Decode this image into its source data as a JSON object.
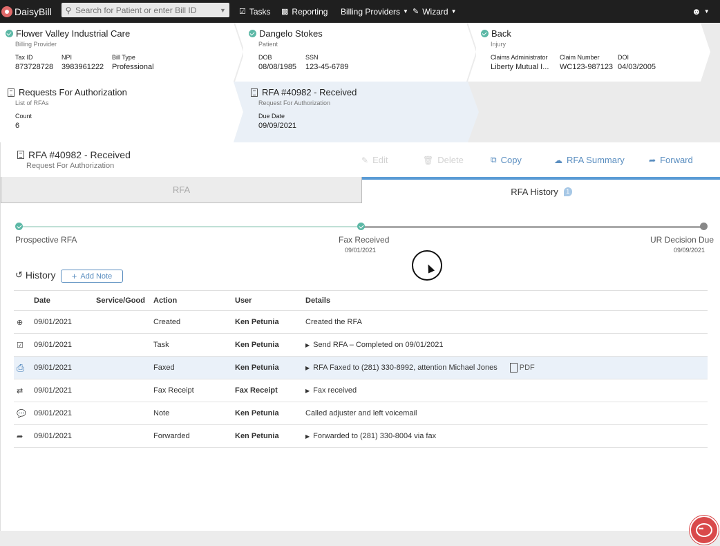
{
  "nav": {
    "logo_text": "DaisyBill",
    "search_placeholder": "Search for Patient or enter Bill ID",
    "tasks": "Tasks",
    "reporting": "Reporting",
    "billing_providers": "Billing Providers",
    "wizard": "Wizard"
  },
  "provider_card": {
    "title": "Flower Valley Industrial Care",
    "subtitle": "Billing Provider",
    "fields": [
      {
        "label": "Tax ID",
        "value": "873728728"
      },
      {
        "label": "NPI",
        "value": "3983961222"
      },
      {
        "label": "Bill Type",
        "value": "Professional"
      }
    ]
  },
  "patient_card": {
    "title": "Dangelo Stokes",
    "subtitle": "Patient",
    "fields": [
      {
        "label": "DOB",
        "value": "08/08/1985"
      },
      {
        "label": "SSN",
        "value": "123-45-6789"
      }
    ]
  },
  "injury_card": {
    "title": "Back",
    "subtitle": "Injury",
    "fields": [
      {
        "label": "Claims Administrator",
        "value": "Liberty Mutual I..."
      },
      {
        "label": "Claim Number",
        "value": "WC123-987123"
      },
      {
        "label": "DOI",
        "value": "04/03/2005"
      }
    ]
  },
  "rfa_list_card": {
    "title": "Requests For Authorization",
    "subtitle": "List of RFAs",
    "field_label": "Count",
    "field_value": "6"
  },
  "rfa_card": {
    "title": "RFA #40982 - Received",
    "subtitle": "Request For Authorization",
    "field_label": "Due Date",
    "field_value": "09/09/2021"
  },
  "page": {
    "title": "RFA #40982 - Received",
    "subtitle": "Request For Authorization",
    "actions": {
      "edit": "Edit",
      "delete": "Delete",
      "copy": "Copy",
      "summary": "RFA Summary",
      "forward": "Forward"
    }
  },
  "tabs": {
    "rfa": "RFA",
    "history": "RFA History",
    "history_badge": "1"
  },
  "timeline": {
    "steps": [
      {
        "label": "Prospective RFA",
        "date": ""
      },
      {
        "label": "Fax Received",
        "date": "09/01/2021"
      },
      {
        "label": "UR Decision Due",
        "date": "09/09/2021"
      }
    ]
  },
  "history": {
    "title": "History",
    "add_note": "Add Note",
    "columns": [
      "Date",
      "Service/Good",
      "Action",
      "User",
      "Details"
    ],
    "rows": [
      {
        "icon": "plus-circle-icon",
        "date": "09/01/2021",
        "service": "",
        "action": "Created",
        "user": "Ken Petunia",
        "details": "Created the RFA",
        "expandable": false
      },
      {
        "icon": "clipboard-check-icon",
        "date": "09/01/2021",
        "service": "",
        "action": "Task",
        "user": "Ken Petunia",
        "details": "Send RFA – Completed on 09/01/2021",
        "expandable": true
      },
      {
        "icon": "fax-icon",
        "date": "09/01/2021",
        "service": "",
        "action": "Faxed",
        "user": "Ken Petunia",
        "details": "RFA Faxed to (281) 330-8992, attention Michael Jones",
        "expandable": true,
        "attachment": "PDF"
      },
      {
        "icon": "exchange-icon",
        "date": "09/01/2021",
        "service": "",
        "action": "Fax Receipt",
        "user": "Fax Receipt",
        "details": "Fax received",
        "expandable": true
      },
      {
        "icon": "comment-icon",
        "date": "09/01/2021",
        "service": "",
        "action": "Note",
        "user": "Ken Petunia",
        "details": "Called adjuster and left voicemail",
        "expandable": false
      },
      {
        "icon": "share-icon",
        "date": "09/01/2021",
        "service": "",
        "action": "Forwarded",
        "user": "Ken Petunia",
        "details": "Forwarded to (281) 330-8004 via fax",
        "expandable": true
      }
    ]
  },
  "colors": {
    "nav_bg": "#1f1f1f",
    "accent_blue": "#5a8ec0",
    "success_green": "#5cb8a6",
    "highlight_row": "#eaf1f9",
    "chat_red": "#d9494a"
  }
}
